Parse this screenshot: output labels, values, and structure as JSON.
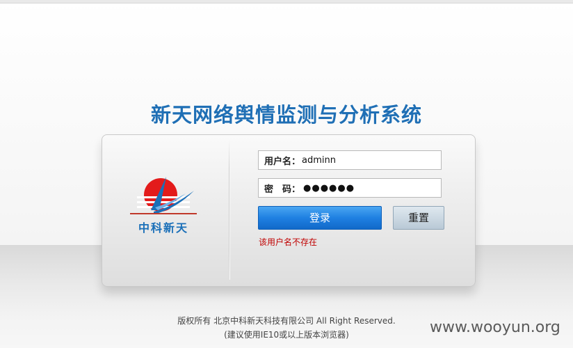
{
  "app": {
    "title": "新天网络舆情监测与分析系统"
  },
  "brand": {
    "logo_text": "中科新天"
  },
  "login": {
    "username_label": "用户名：",
    "username_value": "adminn",
    "password_label": "密　码：",
    "password_mask": "●●●●●●",
    "login_button": "登录",
    "reset_button": "重置",
    "error_message": "该用户名不存在"
  },
  "footer": {
    "copyright": "版权所有  北京中科新天科技有限公司  All Right Reserved.",
    "browser_hint": "(建议使用IE10或以上版本浏览器)"
  },
  "watermark": "www.wooyun.org",
  "colors": {
    "title": "#1f6fb5",
    "login_button": "#1f80e2",
    "error": "#c00000",
    "logo_red": "#e31b1b",
    "logo_blue": "#1a6fb8"
  }
}
